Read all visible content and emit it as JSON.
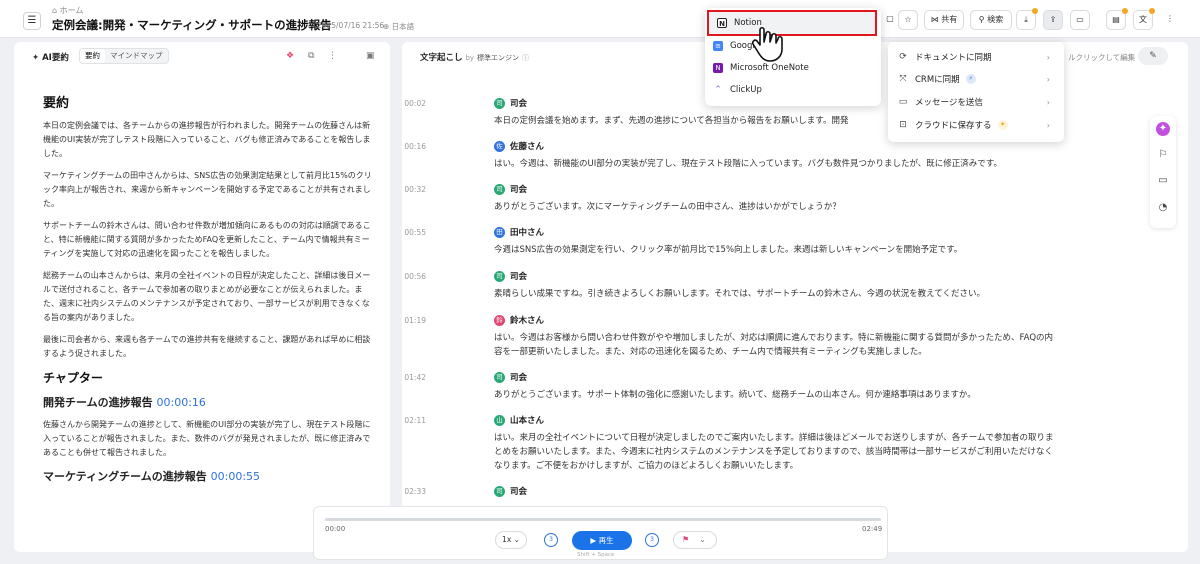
{
  "topbar": {
    "breadcrumb": "ホーム",
    "title": "定例会議:開発・マーケティング・サポートの進捗報告",
    "date": "2025/07/16 21:56",
    "language": "日本語",
    "share_label": "共有",
    "search_label": "検索"
  },
  "export_menu": {
    "items": [
      {
        "label": "Notion",
        "icon": "notion-icon"
      },
      {
        "label": "Google",
        "icon": "google-docs-icon"
      },
      {
        "label": "Microsoft OneNote",
        "icon": "onenote-icon"
      },
      {
        "label": "ClickUp",
        "icon": "clickup-icon"
      }
    ]
  },
  "more_menu": {
    "items": [
      {
        "label": "ドキュメントに同期"
      },
      {
        "label": "CRMに同期"
      },
      {
        "label": "メッセージを送信"
      },
      {
        "label": "クラウドに保存する"
      }
    ]
  },
  "left_panel": {
    "header": "AI要約",
    "tabs": [
      "要約",
      "マインドマップ"
    ],
    "summary_heading": "要約",
    "paragraphs": [
      "本日の定例会議では、各チームからの進捗報告が行われました。開発チームの佐藤さんは新機能のUI実装が完了しテスト段階に入っていること、バグも修正済みであることを報告しました。",
      "マーケティングチームの田中さんからは、SNS広告の効果測定結果として前月比15%のクリック率向上が報告され、来週から新キャンペーンを開始する予定であることが共有されました。",
      "サポートチームの鈴木さんは、問い合わせ件数が増加傾向にあるものの対応は順調であること、特に新機能に関する質問が多かったためFAQを更新したこと、チーム内で情報共有ミーティングを実施して対応の迅速化を図ったことを報告しました。",
      "総務チームの山本さんからは、来月の全社イベントの日程が決定したこと、詳細は後日メールで送付されること、各チームで参加者の取りまとめが必要なことが伝えられました。また、週末に社内システムのメンテナンスが予定されており、一部サービスが利用できなくなる旨の案内がありました。",
      "最後に司会者から、来週も各チームでの進捗共有を継続すること、課題があれば早めに相談するよう促されました。"
    ],
    "chapter_heading": "チャプター",
    "chapters": [
      {
        "title": "開発チームの進捗報告",
        "time": "00:00:16",
        "text": "佐藤さんから開発チームの進捗として、新機能のUI部分の実装が完了し、現在テスト段階に入っていることが報告されました。また、数件のバグが発見されましたが、既に修正済みであることも併せて報告されました。"
      },
      {
        "title": "マーケティングチームの進捗報告",
        "time": "00:00:55"
      }
    ]
  },
  "right_panel": {
    "header": "文字起こし",
    "by": "by",
    "engine": "標準エンジン",
    "edit_hint": "ルクリックして編集",
    "entries": [
      {
        "time": "00:02",
        "speaker": "司会",
        "avatar": "司",
        "color": "#2aa876",
        "text": "本日の定例会議を始めます。まず、先週の進捗について各担当から報告をお願いします。開発"
      },
      {
        "time": "00:16",
        "speaker": "佐藤さん",
        "avatar": "佐",
        "color": "#2f72e0",
        "text": "はい。今週は、新機能のUI部分の実装が完了し、現在テスト段階に入っています。バグも数件見つかりましたが、既に修正済みです。"
      },
      {
        "time": "00:32",
        "speaker": "司会",
        "avatar": "司",
        "color": "#2aa876",
        "text": "ありがとうございます。次にマーケティングチームの田中さん、進捗はいかがでしょうか？"
      },
      {
        "time": "00:55",
        "speaker": "田中さん",
        "avatar": "田",
        "color": "#2f72e0",
        "text": "今週はSNS広告の効果測定を行い、クリック率が前月比で15%向上しました。来週は新しいキャンペーンを開始予定です。"
      },
      {
        "time": "00:56",
        "speaker": "司会",
        "avatar": "司",
        "color": "#2aa876",
        "text": "素晴らしい成果ですね。引き続きよろしくお願いします。それでは、サポートチームの鈴木さん、今週の状況を教えてください。"
      },
      {
        "time": "01:19",
        "speaker": "鈴木さん",
        "avatar": "鈴",
        "color": "#e2456f",
        "text": "はい。今週はお客様から問い合わせ件数がやや増加しましたが、対応は順調に進んでおります。特に新機能に関する質問が多かったため、FAQの内容を一部更新いたしました。また、対応の迅速化を図るため、チーム内で情報共有ミーティングも実施しました。"
      },
      {
        "time": "01:42",
        "speaker": "司会",
        "avatar": "司",
        "color": "#2aa876",
        "text": "ありがとうございます。サポート体制の強化に感謝いたします。続いて、総務チームの山本さん。何か連絡事項はありますか。"
      },
      {
        "time": "02:11",
        "speaker": "山本さん",
        "avatar": "山",
        "color": "#2aa876",
        "text": "はい。来月の全社イベントについて日程が決定しましたのでご案内いたします。詳細は後ほどメールでお送りしますが、各チームで参加者の取りまとめをお願いいたします。また、今週末に社内システムのメンテナンスを予定しておりますので、該当時間帯は一部サービスがご利用いただけなくなります。ご不便をおかけしますが、ご協力のほどよろしくお願いいたします。"
      },
      {
        "time": "02:33",
        "speaker": "司会",
        "avatar": "司",
        "color": "#2aa876",
        "text": ""
      }
    ]
  },
  "player": {
    "current": "00:00",
    "total": "02:49",
    "speed": "1x",
    "back": "3",
    "forward": "3",
    "play_label": "再生",
    "shortcut": "Shift + Space",
    "progress": 0
  }
}
